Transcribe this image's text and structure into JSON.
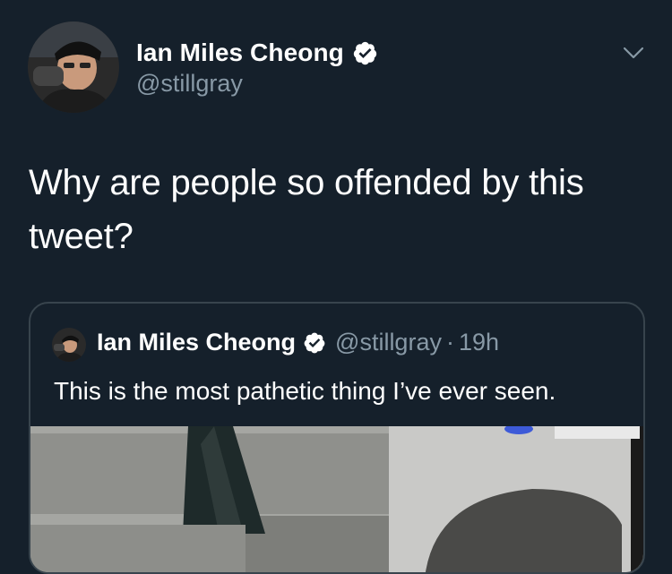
{
  "tweet": {
    "author": {
      "display_name": "Ian Miles Cheong",
      "handle": "@stillgray",
      "verified": true
    },
    "text": "Why are people so offended by this tweet?",
    "menu_icon": "chevron-down-icon"
  },
  "quoted_tweet": {
    "author": {
      "display_name": "Ian Miles Cheong",
      "handle": "@stillgray",
      "verified": true
    },
    "separator": "·",
    "time": "19h",
    "text": "This is the most pathetic thing I’ve ever seen."
  },
  "colors": {
    "background": "#15202b",
    "secondary_text": "#8899a6",
    "border": "#38444d",
    "primary_text": "#ffffff"
  }
}
